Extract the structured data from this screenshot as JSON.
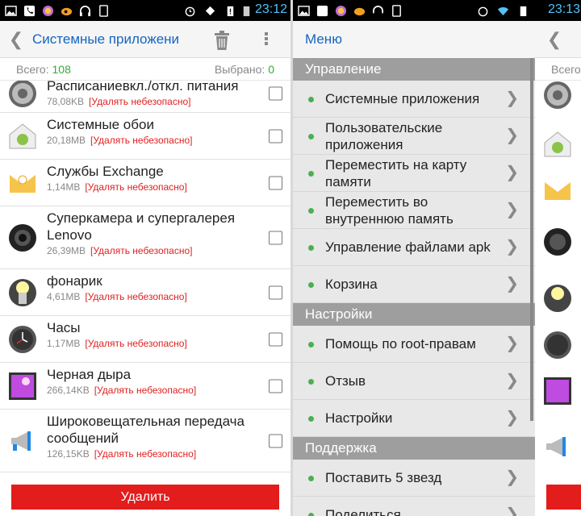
{
  "status": {
    "time": "23:12",
    "time_right": "23:13"
  },
  "header": {
    "back": "❮",
    "title": "Системные приложени"
  },
  "counts": {
    "total_label": "Всего:",
    "total_value": "108",
    "selected_label": "Выбрано:",
    "selected_value": "0"
  },
  "apps": [
    {
      "name": "Расписаниевкл./откл. питания",
      "size": "78,08KB",
      "warning": "[Удалять небезопасно]"
    },
    {
      "name": "Системные обои",
      "size": "20,18MB",
      "warning": "[Удалять небезопасно]"
    },
    {
      "name": "Службы Exchange",
      "size": "1,14MB",
      "warning": "[Удалять небезопасно]"
    },
    {
      "name": "Суперкамера и супергалерея Lenovo",
      "size": "26,39MB",
      "warning": "[Удалять небезопасно]"
    },
    {
      "name": "фонарик",
      "size": "4,61MB",
      "warning": "[Удалять небезопасно]"
    },
    {
      "name": "Часы",
      "size": "1,17MB",
      "warning": "[Удалять небезопасно]"
    },
    {
      "name": "Черная дыра",
      "size": "266,14KB",
      "warning": "[Удалять небезопасно]"
    },
    {
      "name": "Широковещательная передача сообщений",
      "size": "126,15KB",
      "warning": "[Удалять небезопасно]"
    }
  ],
  "delete_button": "Удалить",
  "menu": {
    "title": "Меню",
    "sections": [
      {
        "title": "Управление",
        "items": [
          "Системные приложения",
          "Пользовательские приложения",
          "Переместить на карту памяти",
          "Переместить во внутреннюю память",
          "Управление файлами apk",
          "Корзина"
        ]
      },
      {
        "title": "Настройки",
        "items": [
          "Помощь по root-правам",
          "Отзыв",
          "Настройки"
        ]
      },
      {
        "title": "Поддержка",
        "items": [
          "Поставить 5 звезд",
          "Поделиться"
        ]
      }
    ]
  },
  "right_partial": {
    "count_label": "Всего"
  },
  "colors": {
    "accent": "#1565c0",
    "danger": "#e31c1c",
    "green": "#3aa83a",
    "warn_text": "#e02020"
  }
}
